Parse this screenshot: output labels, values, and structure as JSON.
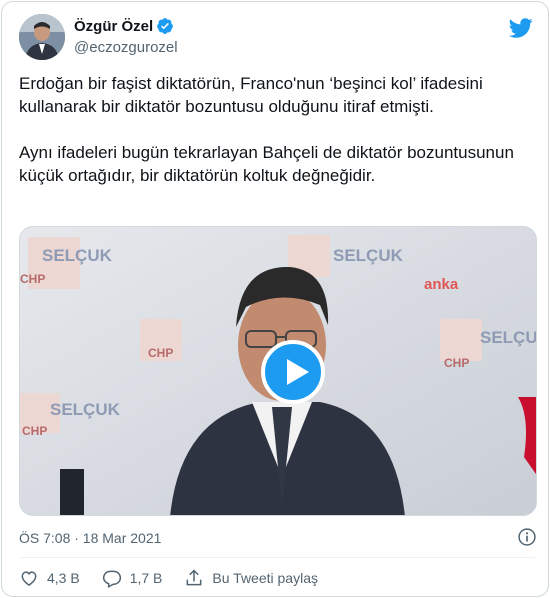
{
  "tweet": {
    "display_name": "Özgür Özel",
    "handle": "@eczozgurozel",
    "paragraphs": [
      "Erdoğan bir faşist diktatörün, Franco'nun ‘beşinci kol’ ifadesini kullanarak bir diktatör bozuntusu olduğunu itiraf etmişti.",
      "Aynı ifadeleri bugün tekrarlayan Bahçeli de diktatör bozuntusunun küçük ortağıdır, bir diktatörün koltuk değneğidir."
    ],
    "timestamp": "ÖS 7:08 · 18 Mar 2021"
  },
  "media": {
    "backdrop_texts": [
      "SELÇUK",
      "CHP",
      "SELÇUK",
      "CHP",
      "SELÇUK",
      "CHP",
      "SELÇUK",
      "CHP"
    ],
    "watermark": "anka"
  },
  "actions": {
    "likes": "4,3 B",
    "replies": "1,7 B",
    "share_label": "Bu Tweeti paylaş"
  },
  "colors": {
    "accent": "#1d9bf0",
    "text_primary": "#0f1419",
    "text_secondary": "#536471",
    "border": "#cfd9de"
  }
}
